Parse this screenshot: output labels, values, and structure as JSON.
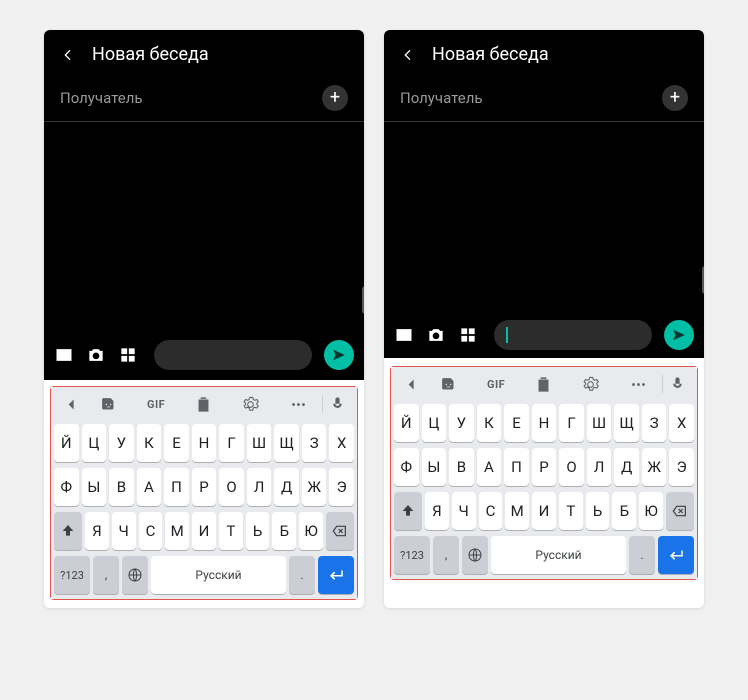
{
  "header": {
    "title": "Новая беседа"
  },
  "recipient": {
    "placeholder": "Получатель"
  },
  "icons": {
    "back": "back-arrow-icon",
    "plus": "plus-icon",
    "gallery": "gallery-icon",
    "camera": "camera-icon",
    "grid": "grid-icon",
    "send": "send-icon",
    "chevron_left": "chevron-left-icon",
    "sticker": "sticker-icon",
    "gif": "GIF",
    "clipboard": "clipboard-icon",
    "settings": "gear-icon",
    "more": "more-icon",
    "mic": "mic-icon",
    "shift": "shift-icon",
    "backspace": "backspace-icon",
    "globe": "globe-icon",
    "emoji": "emoji-icon",
    "enter": "enter-icon"
  },
  "keyboard": {
    "row1": [
      "Й",
      "Ц",
      "У",
      "К",
      "Е",
      "Н",
      "Г",
      "Ш",
      "Щ",
      "З",
      "Х"
    ],
    "row2": [
      "Ф",
      "Ы",
      "В",
      "А",
      "П",
      "Р",
      "О",
      "Л",
      "Д",
      "Ж",
      "Э"
    ],
    "row3": [
      "Я",
      "Ч",
      "С",
      "М",
      "И",
      "Т",
      "Ь",
      "Б",
      "Ю"
    ],
    "symbols_label": "?123",
    "comma": ",",
    "period": ".",
    "space_label": "Русский"
  }
}
